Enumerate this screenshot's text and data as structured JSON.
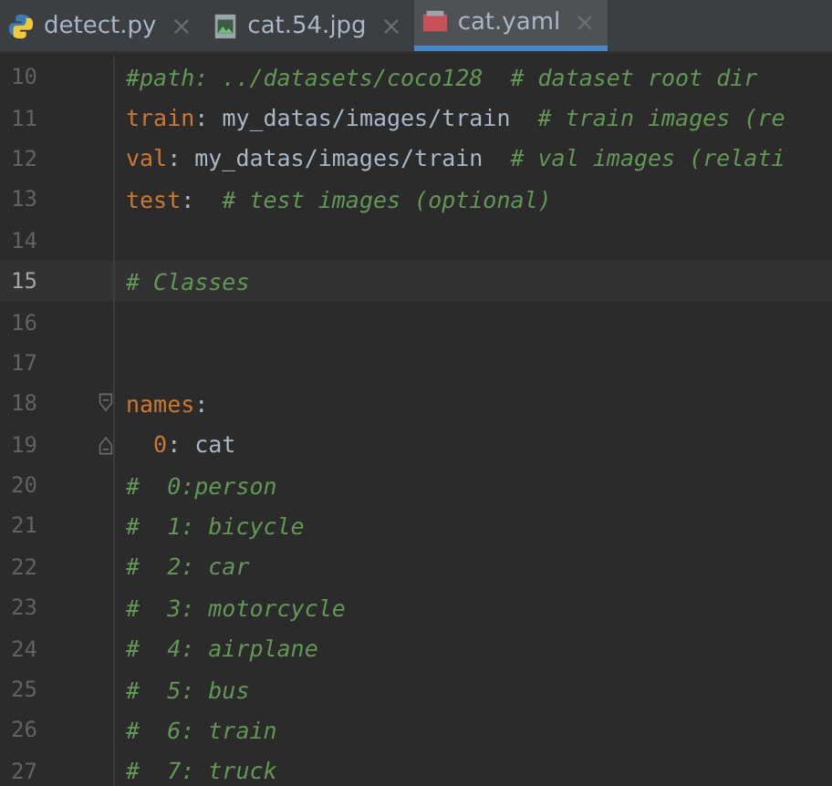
{
  "tabs": [
    {
      "label": "detect.py",
      "kind": "python",
      "selected": false
    },
    {
      "label": "cat.54.jpg",
      "kind": "image",
      "selected": false
    },
    {
      "label": "cat.yaml",
      "kind": "yaml",
      "selected": true
    }
  ],
  "editor": {
    "lines": [
      {
        "number": "10",
        "current": false,
        "kind": "plain",
        "tokens": [
          {
            "kind": "comment",
            "text": "#path: ../datasets/coco128  # dataset root dir"
          }
        ]
      },
      {
        "number": "11",
        "current": false,
        "kind": "plain",
        "tokens": [
          {
            "kind": "key",
            "text": "train"
          },
          {
            "kind": "plain",
            "text": ": my_datas/images/train  "
          },
          {
            "kind": "comment",
            "text": "# train images (re"
          }
        ]
      },
      {
        "number": "12",
        "current": false,
        "kind": "plain",
        "tokens": [
          {
            "kind": "key",
            "text": "val"
          },
          {
            "kind": "plain",
            "text": ": my_datas/images/train  "
          },
          {
            "kind": "comment",
            "text": "# val images (relati"
          }
        ]
      },
      {
        "number": "13",
        "current": false,
        "kind": "plain",
        "tokens": [
          {
            "kind": "key",
            "text": "test"
          },
          {
            "kind": "plain",
            "text": ":  "
          },
          {
            "kind": "comment",
            "text": "# test images (optional)"
          }
        ]
      },
      {
        "number": "14",
        "current": false,
        "kind": "plain"
      },
      {
        "number": "15",
        "current": true,
        "kind": "plain",
        "tokens": [
          {
            "kind": "comment",
            "text": "# Classes"
          }
        ]
      },
      {
        "number": "16",
        "current": false,
        "kind": "plain"
      },
      {
        "number": "17",
        "current": false,
        "kind": "plain"
      },
      {
        "number": "18",
        "current": false,
        "kind": "fold-start",
        "tokens": [
          {
            "kind": "key",
            "text": "names"
          },
          {
            "kind": "plain",
            "text": ":"
          }
        ]
      },
      {
        "number": "19",
        "current": false,
        "kind": "fold-end",
        "tokens": [
          {
            "kind": "number",
            "text": "  0"
          },
          {
            "kind": "plain",
            "text": ": cat"
          }
        ]
      },
      {
        "number": "20",
        "current": false,
        "kind": "plain",
        "tokens": [
          {
            "kind": "comment",
            "text": "#  0:person"
          }
        ]
      },
      {
        "number": "21",
        "current": false,
        "kind": "plain",
        "tokens": [
          {
            "kind": "comment",
            "text": "#  1: bicycle"
          }
        ]
      },
      {
        "number": "22",
        "current": false,
        "kind": "plain",
        "tokens": [
          {
            "kind": "comment",
            "text": "#  2: car"
          }
        ]
      },
      {
        "number": "23",
        "current": false,
        "kind": "plain",
        "tokens": [
          {
            "kind": "comment",
            "text": "#  3: motorcycle"
          }
        ]
      },
      {
        "number": "24",
        "current": false,
        "kind": "plain",
        "tokens": [
          {
            "kind": "comment",
            "text": "#  4: airplane"
          }
        ]
      },
      {
        "number": "25",
        "current": false,
        "kind": "plain",
        "tokens": [
          {
            "kind": "comment",
            "text": "#  5: bus"
          }
        ]
      },
      {
        "number": "26",
        "current": false,
        "kind": "plain",
        "tokens": [
          {
            "kind": "comment",
            "text": "#  6: train"
          }
        ]
      },
      {
        "number": "27",
        "current": false,
        "kind": "plain",
        "tokens": [
          {
            "kind": "comment",
            "text": "#  7: truck"
          }
        ]
      }
    ]
  }
}
